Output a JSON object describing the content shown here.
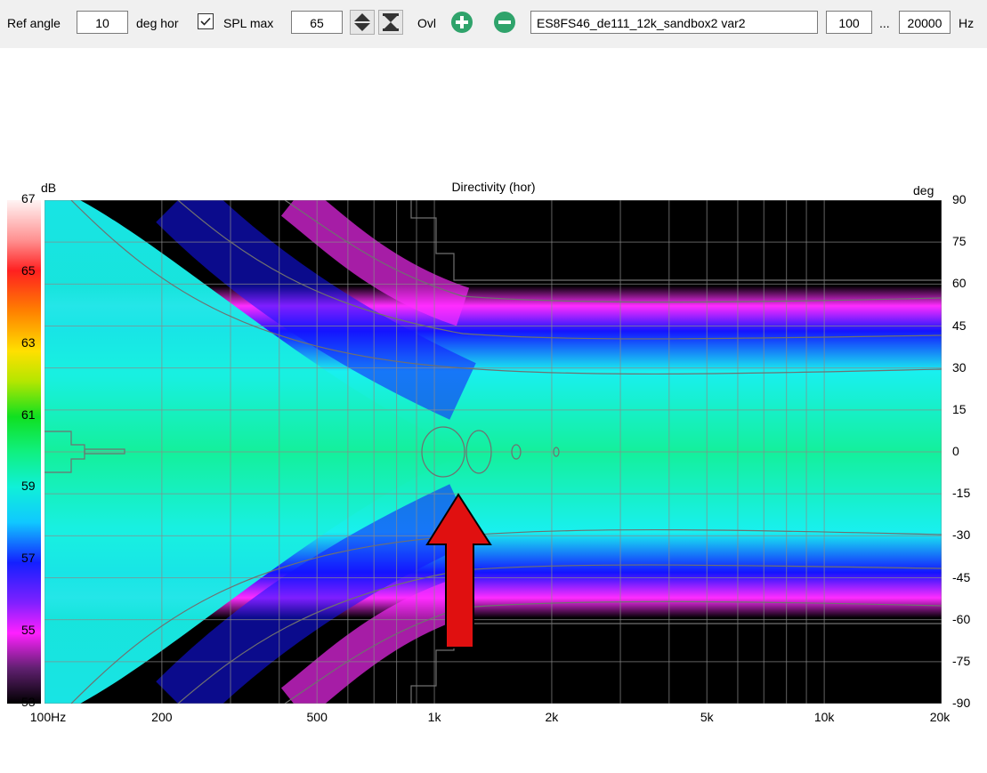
{
  "toolbar": {
    "ref_angle_label": "Ref angle",
    "ref_angle_value": "10",
    "deg_hor_label": "deg hor",
    "spl_max_checked": true,
    "spl_max_label": "SPL max",
    "spl_max_value": "65",
    "ovl_label": "Ovl",
    "add_icon": "plus-circle-icon",
    "remove_icon": "minus-circle-icon",
    "dataset_name": "ES8FS46_de111_12k_sandbox2 var2",
    "freq_min": "100",
    "range_sep": "...",
    "freq_max": "20000",
    "freq_unit": "Hz"
  },
  "chart_data": {
    "type": "heatmap",
    "title": "Directivity (hor)",
    "colorbar_unit": "dB",
    "right_axis_unit": "deg",
    "colorbar_ticks": [
      "67",
      "65",
      "63",
      "61",
      "59",
      "57",
      "55",
      "53"
    ],
    "colorbar_range": [
      53,
      67
    ],
    "x_scale": "log",
    "x_range_hz": [
      100,
      20000
    ],
    "x_tick_labels": [
      "100Hz",
      "200",
      "500",
      "1k",
      "2k",
      "5k",
      "10k",
      "20k"
    ],
    "x_tick_values": [
      100,
      200,
      500,
      1000,
      2000,
      5000,
      10000,
      20000
    ],
    "y_range_deg": [
      -90,
      90
    ],
    "y_ticks": [
      "90",
      "75",
      "60",
      "45",
      "30",
      "15",
      "0",
      "-15",
      "-30",
      "-45",
      "-60",
      "-75",
      "-90"
    ],
    "grid": true,
    "annotation": "red-arrow-up",
    "colors": {
      "cyan": "#19f0f0",
      "green": "#14f09b",
      "blue": "#1414ff",
      "magenta": "#ff2cff",
      "black": "#000000",
      "arrow": "#e01010"
    }
  }
}
